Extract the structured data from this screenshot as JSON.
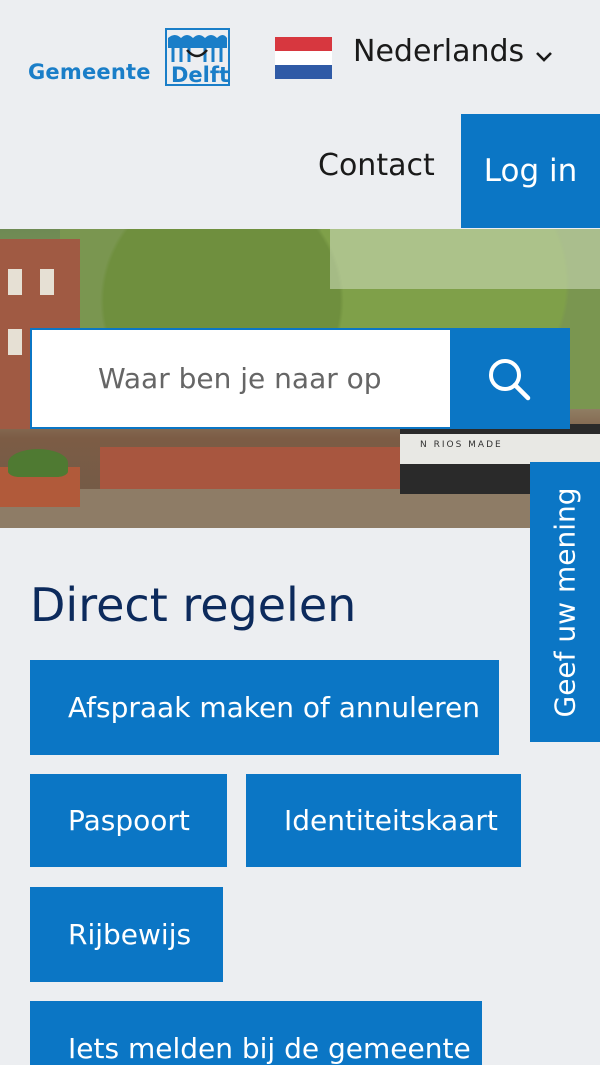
{
  "header": {
    "logo_text_1": "Gemeente",
    "logo_text_2": "Delft",
    "language_label": "Nederlands",
    "language_icon": "netherlands-flag-icon",
    "contact_label": "Contact",
    "login_label": "Log in"
  },
  "search": {
    "placeholder": "Waar ben je naar op",
    "button_icon": "search-icon"
  },
  "direct_regelen": {
    "title": "Direct regelen",
    "buttons": [
      {
        "label": "Afspraak maken of annuleren"
      },
      {
        "label": "Paspoort"
      },
      {
        "label": "Identiteitskaart"
      },
      {
        "label": "Rijbewijs"
      },
      {
        "label": "Iets melden bij de gemeente"
      }
    ]
  },
  "feedback": {
    "label": "Geef uw mening"
  },
  "colors": {
    "accent": "#0b76c5",
    "background": "#eceef1",
    "heading": "#0c2a5c"
  }
}
